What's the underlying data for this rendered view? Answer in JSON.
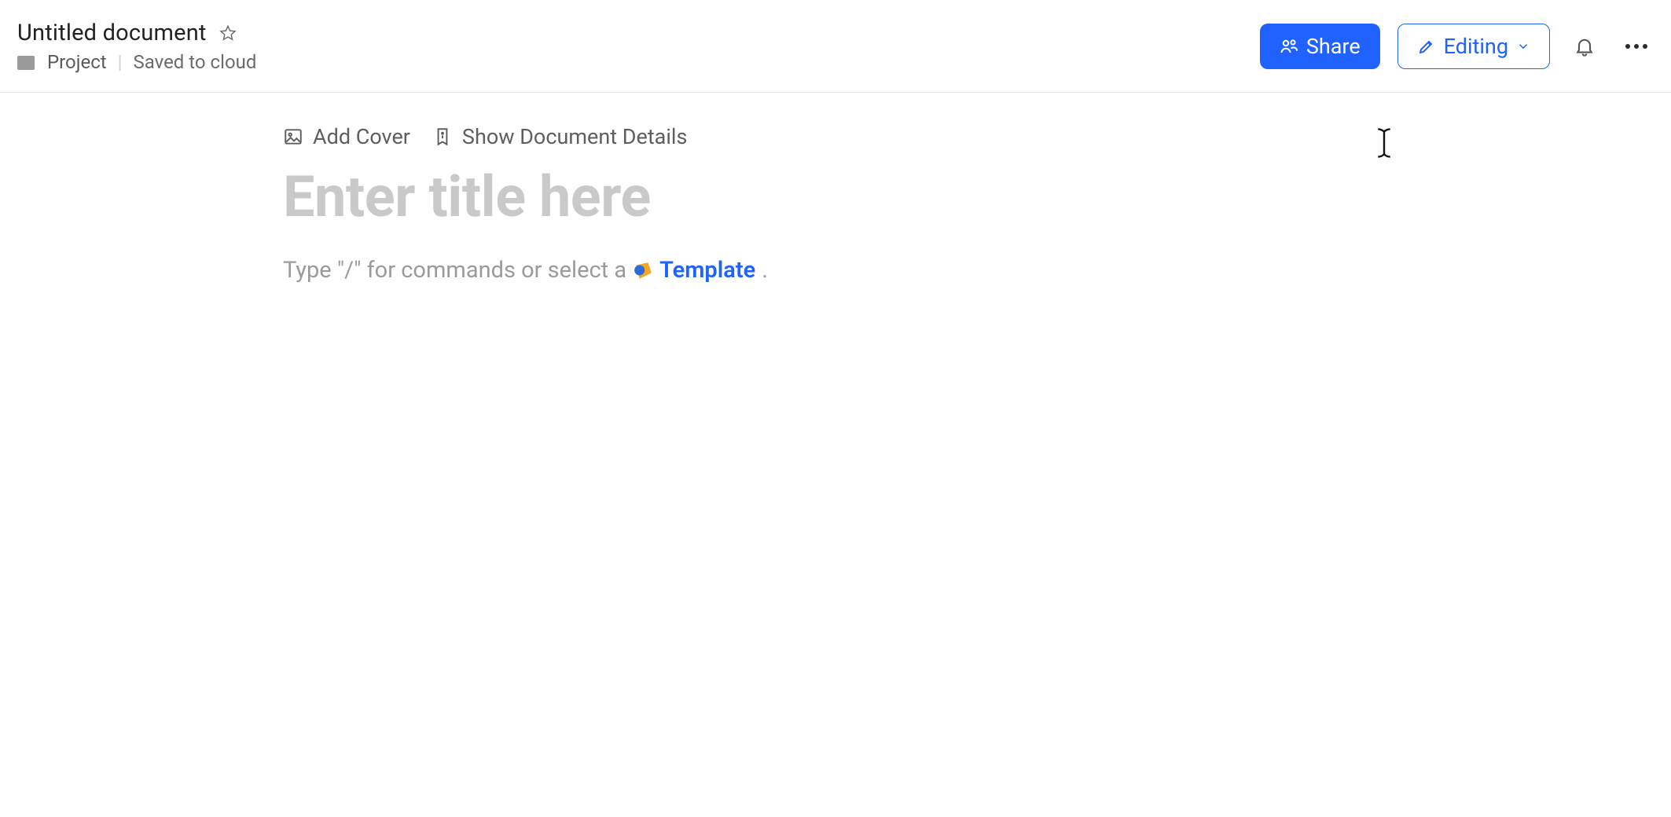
{
  "header": {
    "title": "Untitled document",
    "folder_label": "Project",
    "saved_label": "Saved to cloud",
    "share_button": "Share",
    "editing_button": "Editing"
  },
  "doc": {
    "add_cover_label": "Add Cover",
    "show_details_label": "Show Document Details",
    "title_placeholder": "Enter title here",
    "slash_hint_prefix": "Type \"/\" for commands or select a",
    "template_link": "Template",
    "slash_hint_suffix": "."
  }
}
